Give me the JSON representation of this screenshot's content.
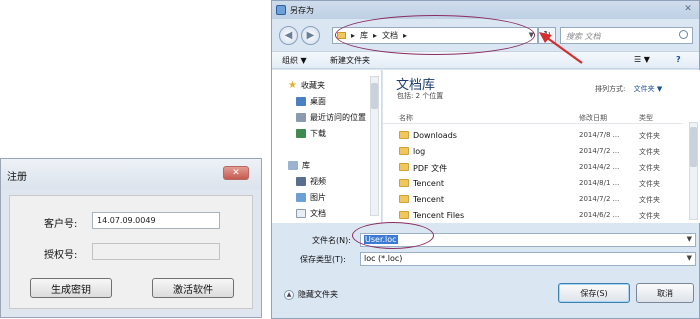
{
  "register_dialog": {
    "title": "注册",
    "close_glyph": "✕",
    "customer_label": "客户号:",
    "customer_value": "14.07.09.0049",
    "auth_label": "授权号:",
    "auth_value": "",
    "generate_button": "生成密钥",
    "activate_button": "激活软件"
  },
  "save_dialog": {
    "title": "另存为",
    "close_glyph": "✕",
    "back_glyph": "◀",
    "forward_glyph": "▶",
    "refresh_glyph": "↻",
    "address": {
      "segments": [
        "库",
        "文档"
      ],
      "separator": "▸",
      "dropdown_glyph": "▼"
    },
    "search_placeholder": "搜索 文档",
    "toolbar": {
      "organize": "组织 ▼",
      "new_folder": "新建文件夹",
      "view_glyph": "☰ ▼",
      "help_glyph": "?"
    },
    "nav_items": [
      "收藏夹",
      "桌面",
      "最近访问的位置",
      "下载",
      "库",
      "视频",
      "图片",
      "文档"
    ],
    "library": {
      "title": "文档库",
      "subtitle": "包括: 2 个位置",
      "arrange_label": "排列方式:",
      "arrange_value": "文件夹 ▼"
    },
    "columns": [
      "名称",
      "修改日期",
      "类型"
    ],
    "files": [
      {
        "name": "Downloads",
        "date": "2014/7/8 ...",
        "type": "文件夹"
      },
      {
        "name": "log",
        "date": "2014/7/2 ...",
        "type": "文件夹"
      },
      {
        "name": "PDF 文件",
        "date": "2014/4/2 ...",
        "type": "文件夹"
      },
      {
        "name": "Tencent",
        "date": "2014/8/1 ...",
        "type": "文件夹"
      },
      {
        "name": "Tencent",
        "date": "2014/7/2 ...",
        "type": "文件夹"
      },
      {
        "name": "Tencent Files",
        "date": "2014/6/2 ...",
        "type": "文件夹"
      }
    ],
    "filename_label": "文件名(N):",
    "filename_value": "User.loc",
    "filetype_label": "保存类型(T):",
    "filetype_value": "loc (*.loc)",
    "hide_folders": "隐藏文件夹",
    "save_button": "保存(S)",
    "cancel_button": "取消"
  },
  "colors": {
    "annotation": "#8a2d62",
    "arrow": "#d32f2f",
    "selection": "#3b79d4",
    "folder": "#f0c75e"
  }
}
